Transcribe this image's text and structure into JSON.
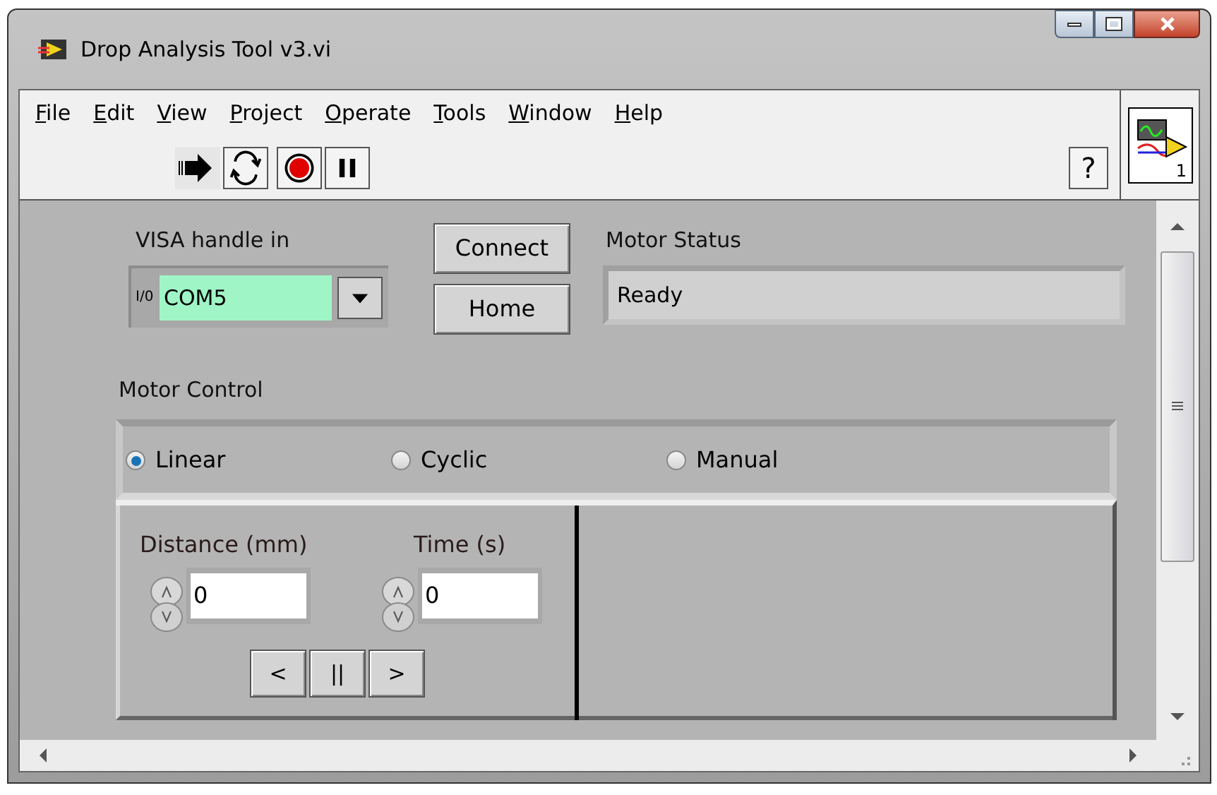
{
  "window": {
    "title": "Drop Analysis Tool v3.vi"
  },
  "menu": [
    "File",
    "Edit",
    "View",
    "Project",
    "Operate",
    "Tools",
    "Window",
    "Help"
  ],
  "toolbar": {
    "help_button": "?",
    "vi_icon_number": "1"
  },
  "visa": {
    "label": "VISA handle in",
    "prefix": "I/0",
    "value": "COM5"
  },
  "buttons": [
    "Connect",
    "Home"
  ],
  "motor_status": {
    "label": "Motor Status",
    "value": "Ready"
  },
  "motor_control": {
    "label": "Motor Control",
    "options": [
      {
        "label": "Linear",
        "selected": true
      },
      {
        "label": "Cyclic",
        "selected": false
      },
      {
        "label": "Manual",
        "selected": false
      }
    ]
  },
  "numerics": [
    {
      "label": "Distance (mm)",
      "value": "0"
    },
    {
      "label": "Time (s)",
      "value": "0"
    }
  ],
  "nav_buttons": [
    "<",
    "||",
    ">"
  ]
}
